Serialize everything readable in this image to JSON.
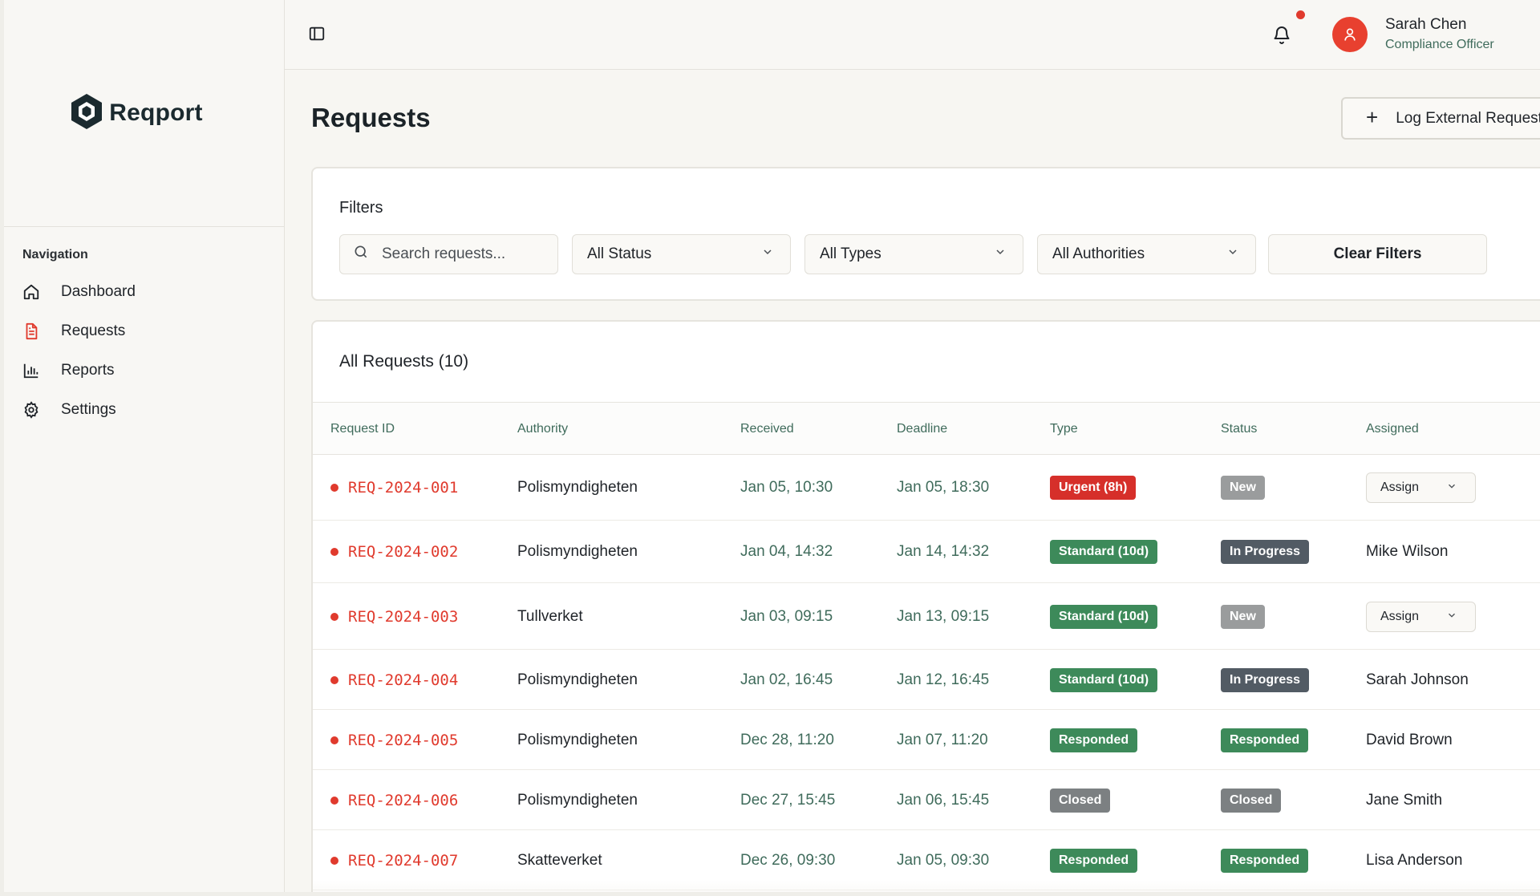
{
  "brand": {
    "name": "Reqport"
  },
  "colors": {
    "accent": "#e03a2d",
    "muted_text": "#3f6b5b",
    "urgent": "#d62f2a",
    "standard": "#3d8a5a",
    "responded": "#3d8a5a",
    "new": "#9a9c9d",
    "in_progress": "#525b64",
    "closed": "#7c8082"
  },
  "sidebar": {
    "title": "Navigation",
    "items": [
      {
        "label": "Dashboard",
        "icon": "home-icon",
        "active": false
      },
      {
        "label": "Requests",
        "icon": "document-icon",
        "active": true
      },
      {
        "label": "Reports",
        "icon": "bar-chart-icon",
        "active": false
      },
      {
        "label": "Settings",
        "icon": "gear-icon",
        "active": false
      }
    ]
  },
  "header": {
    "toggle_icon": "sidebar-toggle-icon",
    "notification_icon": "bell-icon",
    "user": {
      "name": "Sarah Chen",
      "role": "Compliance Officer",
      "avatar_icon": "user-icon"
    }
  },
  "page": {
    "title": "Requests",
    "log_button": "Log External Request"
  },
  "filters": {
    "title": "Filters",
    "search_placeholder": "Search requests...",
    "status": "All Status",
    "types": "All Types",
    "authorities": "All Authorities",
    "clear": "Clear Filters"
  },
  "table": {
    "title": "All Requests (10)",
    "columns": [
      "Request ID",
      "Authority",
      "Received",
      "Deadline",
      "Type",
      "Status",
      "Assigned"
    ],
    "rows": [
      {
        "id": "REQ-2024-001",
        "authority": "Polismyndigheten",
        "received": "Jan 05, 10:30",
        "deadline": "Jan 05, 18:30",
        "type": "Urgent (8h)",
        "type_kind": "urgent",
        "status": "New",
        "status_kind": "new",
        "assigned": "Assign",
        "assign_dropdown": true
      },
      {
        "id": "REQ-2024-002",
        "authority": "Polismyndigheten",
        "received": "Jan 04, 14:32",
        "deadline": "Jan 14, 14:32",
        "type": "Standard (10d)",
        "type_kind": "standard",
        "status": "In Progress",
        "status_kind": "in_progress",
        "assigned": "Mike Wilson",
        "assign_dropdown": false
      },
      {
        "id": "REQ-2024-003",
        "authority": "Tullverket",
        "received": "Jan 03, 09:15",
        "deadline": "Jan 13, 09:15",
        "type": "Standard (10d)",
        "type_kind": "standard",
        "status": "New",
        "status_kind": "new",
        "assigned": "Assign",
        "assign_dropdown": true
      },
      {
        "id": "REQ-2024-004",
        "authority": "Polismyndigheten",
        "received": "Jan 02, 16:45",
        "deadline": "Jan 12, 16:45",
        "type": "Standard (10d)",
        "type_kind": "standard",
        "status": "In Progress",
        "status_kind": "in_progress",
        "assigned": "Sarah Johnson",
        "assign_dropdown": false
      },
      {
        "id": "REQ-2024-005",
        "authority": "Polismyndigheten",
        "received": "Dec 28, 11:20",
        "deadline": "Jan 07, 11:20",
        "type": "Responded",
        "type_kind": "responded",
        "status": "Responded",
        "status_kind": "responded",
        "assigned": "David Brown",
        "assign_dropdown": false
      },
      {
        "id": "REQ-2024-006",
        "authority": "Polismyndigheten",
        "received": "Dec 27, 15:45",
        "deadline": "Jan 06, 15:45",
        "type": "Closed",
        "type_kind": "closed",
        "status": "Closed",
        "status_kind": "closed",
        "assigned": "Jane Smith",
        "assign_dropdown": false
      },
      {
        "id": "REQ-2024-007",
        "authority": "Skatteverket",
        "received": "Dec 26, 09:30",
        "deadline": "Jan 05, 09:30",
        "type": "Responded",
        "type_kind": "responded",
        "status": "Responded",
        "status_kind": "responded",
        "assigned": "Lisa Anderson",
        "assign_dropdown": false
      }
    ]
  }
}
